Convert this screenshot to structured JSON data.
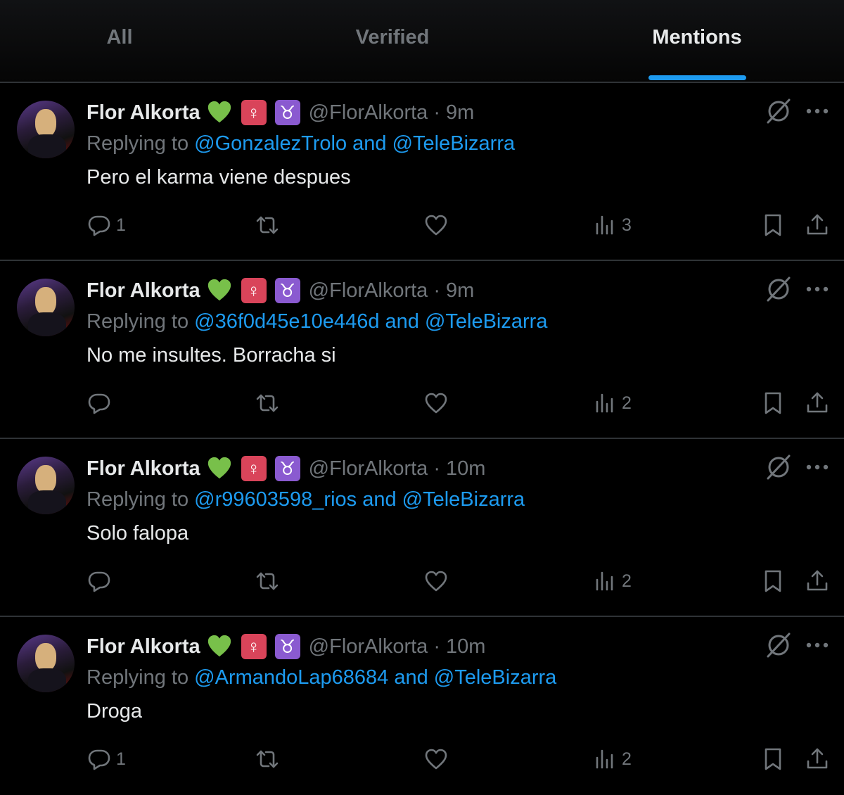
{
  "tabs": [
    {
      "label": "All",
      "active": false
    },
    {
      "label": "Verified",
      "active": false
    },
    {
      "label": "Mentions",
      "active": true
    }
  ],
  "colors": {
    "background": "#000000",
    "accent": "#1d9bf0",
    "muted": "#71767b",
    "text": "#e7e9ea",
    "divider": "#2f3336"
  },
  "tweets": [
    {
      "name": "Flor Alkorta",
      "emojis": [
        "green-heart",
        "female-sign",
        "taurus"
      ],
      "handle": "@FlorAlkorta",
      "time": "· 9m",
      "reply_prefix": "Replying to ",
      "reply_user1": "@GonzalezTrolo",
      "reply_and": " and ",
      "reply_user2": "@TeleBizarra",
      "text": "Pero el karma viene despues",
      "replies": "1",
      "retweets": "",
      "likes": "",
      "views": "3"
    },
    {
      "name": "Flor Alkorta",
      "emojis": [
        "green-heart",
        "female-sign",
        "taurus"
      ],
      "handle": "@FlorAlkorta",
      "time": "· 9m",
      "reply_prefix": "Replying to ",
      "reply_user1": "@36f0d45e10e446d",
      "reply_and": " and ",
      "reply_user2": "@TeleBizarra",
      "text": "No me insultes. Borracha si",
      "replies": "",
      "retweets": "",
      "likes": "",
      "views": "2"
    },
    {
      "name": "Flor Alkorta",
      "emojis": [
        "green-heart",
        "female-sign",
        "taurus"
      ],
      "handle": "@FlorAlkorta",
      "time": "· 10m",
      "reply_prefix": "Replying to ",
      "reply_user1": "@r99603598_rios",
      "reply_and": " and ",
      "reply_user2": "@TeleBizarra",
      "text": "Solo falopa",
      "replies": "",
      "retweets": "",
      "likes": "",
      "views": "2"
    },
    {
      "name": "Flor Alkorta",
      "emojis": [
        "green-heart",
        "female-sign",
        "taurus"
      ],
      "handle": "@FlorAlkorta",
      "time": "· 10m",
      "reply_prefix": "Replying to ",
      "reply_user1": "@ArmandoLap68684",
      "reply_and": " and ",
      "reply_user2": "@TeleBizarra",
      "text": "Droga",
      "replies": "1",
      "retweets": "",
      "likes": "",
      "views": "2"
    }
  ],
  "emoji_glyphs": {
    "female": "♀",
    "taurus": "♉"
  }
}
